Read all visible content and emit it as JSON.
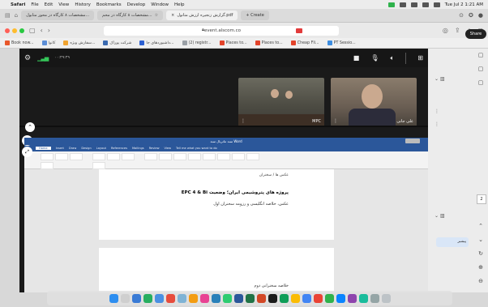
{
  "menubar": {
    "app": "Safari",
    "items": [
      "File",
      "Edit",
      "View",
      "History",
      "Bookmarks",
      "Develop",
      "Window",
      "Help"
    ],
    "datetime": "Tue Jul 2  1:21 AM"
  },
  "tabs": [
    {
      "label": "مشخصات ۸ کارگاه در محور متابول..."
    },
    {
      "label": "مشخصات ۸ کارگاه در محم..."
    },
    {
      "label": "گزارش زنجیره ارزش متانول.pdf"
    },
    {
      "label": "+ Create"
    }
  ],
  "toolbar": {
    "address": "event.alscom.co"
  },
  "bookmarks": [
    {
      "label": "Book now...",
      "color": "#e8572a"
    },
    {
      "label": "کانوا",
      "color": "#5c8ed6"
    },
    {
      "label": "سفارش ویژه...",
      "color": "#f0a330"
    },
    {
      "label": "شرکت پوراک",
      "color": "#3a6ab0"
    },
    {
      "label": "داشبوردهای جا...",
      "color": "#2b5fd1"
    },
    {
      "label": "(2) registr...",
      "color": "#9aa0a6"
    },
    {
      "label": "Places to...",
      "color": "#e2432a"
    },
    {
      "label": "Places to...",
      "color": "#e2432a"
    },
    {
      "label": "Cheap Fli...",
      "color": "#e2432a"
    },
    {
      "label": "PT Sessio...",
      "color": "#3c8de0"
    }
  ],
  "meeting": {
    "top_status": "۰۰:۴۹:۴۹",
    "participants": [
      {
        "name": "MPC"
      },
      {
        "name": "علی جانی"
      }
    ],
    "share_label": "Share"
  },
  "word": {
    "title": "سند ماتریال سند Word",
    "tabs": [
      "Home",
      "Insert",
      "Draw",
      "Design",
      "Layout",
      "References",
      "Mailings",
      "Review",
      "View",
      "Tell me what you want to do"
    ],
    "page1": {
      "line1": "عکس ها / سخنران",
      "line2": "پروژه های پتروشیمی ایران؛ وضعیت EPC 4 & Bi",
      "line3": "عکس، خلاصه انگلیسی و رزومه سخنران اول"
    },
    "page2": {
      "line1": "خلاصه سخنرانی دوم"
    }
  },
  "side": {
    "chat_preview": "پیشبر"
  },
  "colors": {
    "signal": "#35c759",
    "word_blue": "#2b579a",
    "record_red": "#e23b3b"
  }
}
